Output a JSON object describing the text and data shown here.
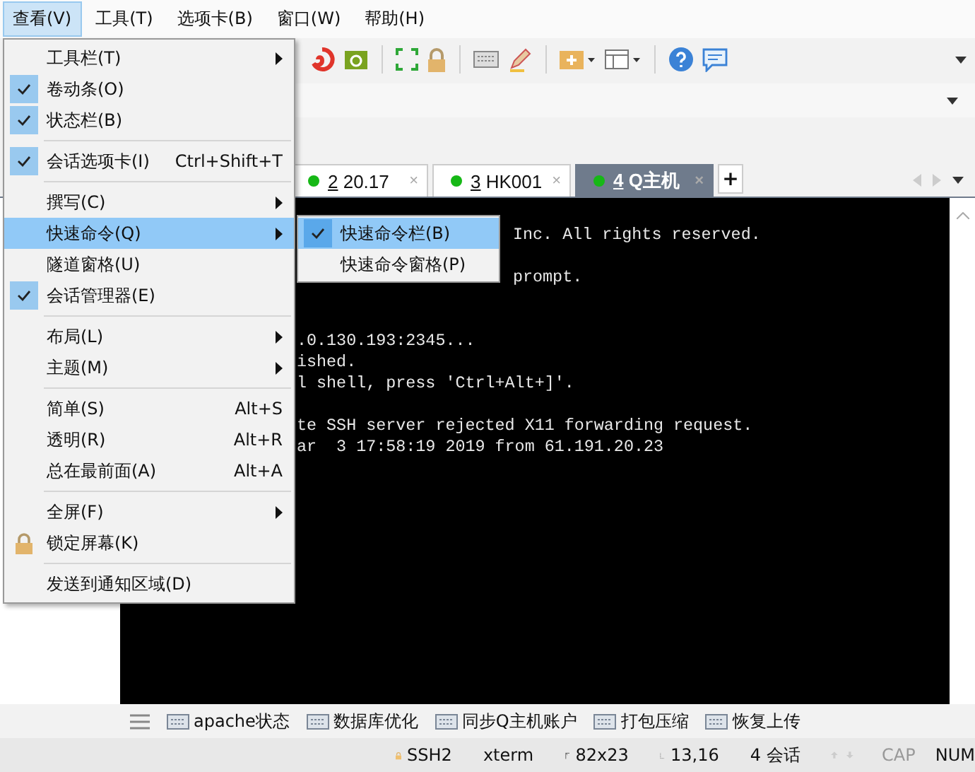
{
  "menubar": [
    {
      "label": "查看(V)",
      "selected": true
    },
    {
      "label": "工具(T)",
      "selected": false
    },
    {
      "label": "选项卡(B)",
      "selected": false
    },
    {
      "label": "窗口(W)",
      "selected": false
    },
    {
      "label": "帮助(H)",
      "selected": false
    }
  ],
  "tabs": [
    {
      "number": "2",
      "label": "20.17",
      "close": "×",
      "selected": false
    },
    {
      "number": "3",
      "label": "HK001",
      "close": "×",
      "selected": false
    },
    {
      "number": "4",
      "label": "Q主机",
      "close": "×",
      "selected": true
    }
  ],
  "new_tab": "+",
  "terminal": {
    "lines": [
      "Inc. All rights reserved.",
      "prompt.",
      ".0.130.193:2345...",
      "ished.",
      "l shell, press 'Ctrl+Alt+]'.",
      "te SSH server rejected X11 forwarding request.",
      "ar  3 17:58:19 2019 from 61.191.20.23"
    ]
  },
  "menu": {
    "groups": [
      [
        {
          "label": "工具栏(T)",
          "kind": "check",
          "checked": false,
          "submenu": true,
          "highlighted": false
        },
        {
          "label": "卷动条(O)",
          "kind": "check",
          "checked": true,
          "submenu": false,
          "highlighted": false
        },
        {
          "label": "状态栏(B)",
          "kind": "check",
          "checked": true,
          "submenu": false,
          "highlighted": false
        }
      ],
      [
        {
          "label": "会话选项卡(I)",
          "kind": "check",
          "checked": true,
          "submenu": false,
          "highlighted": false,
          "shortcut": "Ctrl+Shift+T"
        }
      ],
      [
        {
          "label": "撰写(C)",
          "kind": "check",
          "checked": false,
          "submenu": true,
          "highlighted": false
        },
        {
          "label": "快速命令(Q)",
          "kind": "check",
          "checked": false,
          "submenu": true,
          "highlighted": true
        },
        {
          "label": "隧道窗格(U)",
          "kind": "check",
          "checked": false,
          "submenu": false,
          "highlighted": false
        },
        {
          "label": "会话管理器(E)",
          "kind": "check",
          "checked": true,
          "submenu": false,
          "highlighted": false
        }
      ],
      [
        {
          "label": "布局(L)",
          "kind": "check",
          "checked": false,
          "submenu": true,
          "highlighted": false
        },
        {
          "label": "主题(M)",
          "kind": "check",
          "checked": false,
          "submenu": true,
          "highlighted": false
        }
      ],
      [
        {
          "label": "简单(S)",
          "kind": "check",
          "checked": false,
          "submenu": false,
          "highlighted": false,
          "shortcut": "Alt+S"
        },
        {
          "label": "透明(R)",
          "kind": "check",
          "checked": false,
          "submenu": false,
          "highlighted": false,
          "shortcut": "Alt+R"
        },
        {
          "label": "总在最前面(A)",
          "kind": "check",
          "checked": false,
          "submenu": false,
          "highlighted": false,
          "shortcut": "Alt+A"
        }
      ],
      [
        {
          "label": "全屏(F)",
          "kind": "check",
          "checked": false,
          "submenu": true,
          "highlighted": false
        },
        {
          "label": "锁定屏幕(K)",
          "kind": "lock",
          "submenu": false,
          "highlighted": false
        }
      ],
      [
        {
          "label": "发送到通知区域(D)",
          "kind": "check",
          "checked": false,
          "submenu": false,
          "highlighted": false
        }
      ]
    ]
  },
  "submenu": {
    "items": [
      {
        "label": "快速命令栏(B)",
        "checked": true,
        "highlighted": true
      },
      {
        "label": "快速命令窗格(P)",
        "checked": false,
        "highlighted": false
      }
    ]
  },
  "quick_commands": [
    "apache状态",
    "数据库优化",
    "同步Q主机账户",
    "打包压缩",
    "恢复上传"
  ],
  "status_bar": {
    "items": [
      {
        "kind": "ssh",
        "text": "SSH2"
      },
      {
        "kind": "plain",
        "text": "xterm"
      },
      {
        "kind": "size",
        "text": "82x23"
      },
      {
        "kind": "cursor",
        "text": "13,16"
      },
      {
        "kind": "plain",
        "text": "4 会话"
      }
    ],
    "indicators": [
      {
        "label": "CAP",
        "on": false
      },
      {
        "label": "NUM",
        "on": true
      }
    ]
  }
}
